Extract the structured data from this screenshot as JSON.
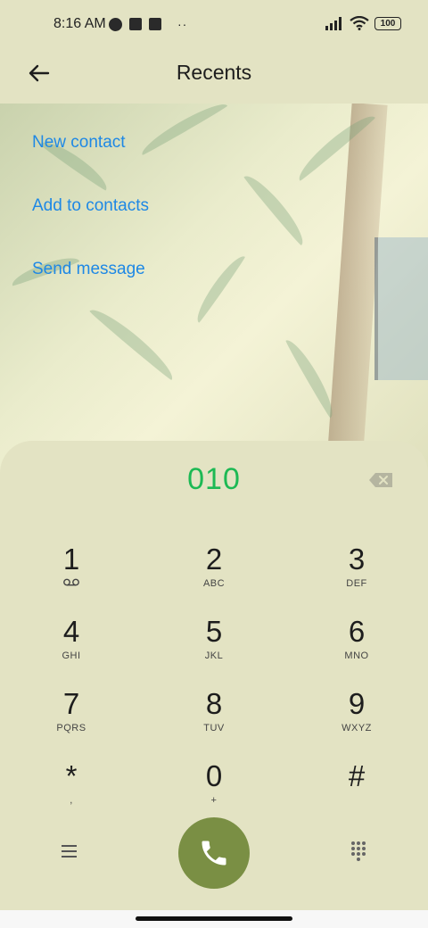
{
  "status_bar": {
    "time": "8:16 AM",
    "dots": "··",
    "battery": "100"
  },
  "header": {
    "title": "Recents",
    "back_icon": "arrow-left-icon"
  },
  "actions": [
    {
      "label": "New contact"
    },
    {
      "label": "Add to contacts"
    },
    {
      "label": "Send message"
    }
  ],
  "dialer": {
    "number": "010",
    "keys": [
      {
        "digit": "1",
        "letters": ""
      },
      {
        "digit": "2",
        "letters": "ABC"
      },
      {
        "digit": "3",
        "letters": "DEF"
      },
      {
        "digit": "4",
        "letters": "GHI"
      },
      {
        "digit": "5",
        "letters": "JKL"
      },
      {
        "digit": "6",
        "letters": "MNO"
      },
      {
        "digit": "7",
        "letters": "PQRS"
      },
      {
        "digit": "8",
        "letters": "TUV"
      },
      {
        "digit": "9",
        "letters": "WXYZ"
      },
      {
        "digit": "*",
        "letters": ","
      },
      {
        "digit": "0",
        "letters": "+"
      },
      {
        "digit": "#",
        "letters": ""
      }
    ]
  },
  "colors": {
    "accent": "#1e88e5",
    "number": "#1db954",
    "call": "#7a8f44",
    "panel": "#e3e3c3"
  }
}
